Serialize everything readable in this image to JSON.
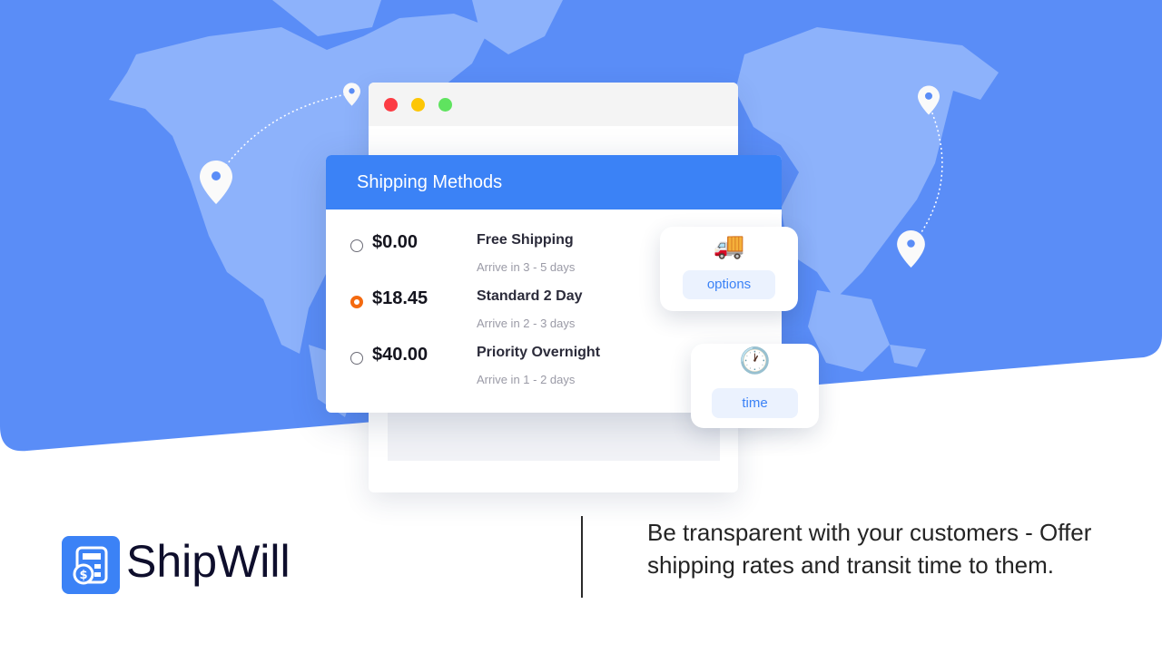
{
  "colors": {
    "hero_blue": "#5a8df7",
    "land_blue": "#8db2fb",
    "accent_blue": "#3b82f6",
    "selected_radio": "#f46a10",
    "window_red": "#fc3c44",
    "window_yellow": "#fdc605",
    "window_green": "#5fe35f"
  },
  "shipping": {
    "title": "Shipping Methods",
    "rates": [
      {
        "price": "$0.00",
        "name": "Free Shipping",
        "eta": "Arrive in 3 - 5 days",
        "selected": false
      },
      {
        "price": "$18.45",
        "name": "Standard 2 Day",
        "eta": "Arrive in 2 - 3 days",
        "selected": true
      },
      {
        "price": "$40.00",
        "name": "Priority Overnight",
        "eta": "Arrive in 1 - 2 days",
        "selected": false
      }
    ]
  },
  "tiles": {
    "options": {
      "icon": "delivery-truck-icon",
      "emoji": "🚚",
      "label": "options"
    },
    "time": {
      "icon": "clock-icon",
      "emoji": "🕐",
      "label": "time"
    }
  },
  "brand": {
    "name": "ShipWill",
    "logo_icon": "calculator-dollar-icon"
  },
  "tagline": "Be transparent with your customers - Offer shipping rates and transit time to them."
}
